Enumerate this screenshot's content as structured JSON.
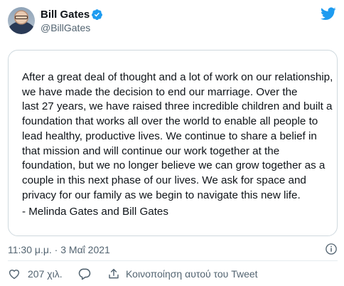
{
  "author": {
    "display_name": "Bill Gates",
    "handle": "@BillGates",
    "verified": true,
    "avatar_icon": "user-avatar"
  },
  "tweet": {
    "lines": [
      "After a great deal of thought and a lot of work on our relationship,",
      "we have made the decision to end our marriage. Over the",
      "last 27 years, we have raised three incredible children and built a",
      "foundation that works all over the world to enable all people to",
      "lead healthy, productive lives. We continue to share a belief in",
      "that mission and will continue our work together at the",
      "foundation, but we no longer believe we can grow together as a",
      "couple in this next phase of our lives. We ask for space and",
      "privacy for our family as we begin to navigate this new life."
    ],
    "signature": "- Melinda Gates and Bill Gates",
    "timestamp": "11:30 μ.μ. · 3 Μαΐ 2021"
  },
  "actions": {
    "like_count": "207 χιλ.",
    "share_label": "Κοινοποίηση αυτού του Tweet"
  },
  "colors": {
    "twitter_blue": "#1d9bf0",
    "secondary_text": "#536471",
    "border": "#cfd9de"
  }
}
